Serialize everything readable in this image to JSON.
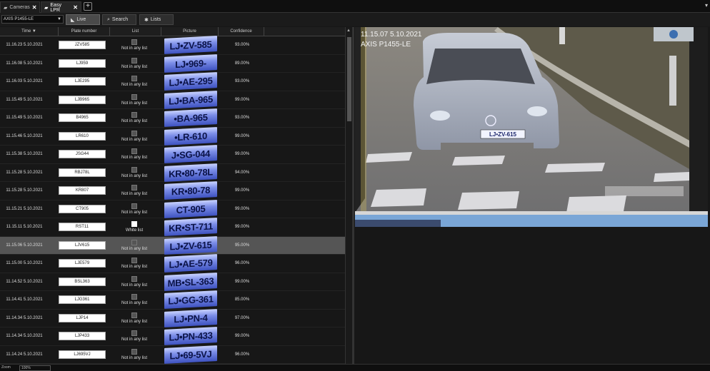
{
  "tabs": [
    {
      "label": "Cameras",
      "close": "✕"
    },
    {
      "label": "Easy LPR",
      "close": "✕"
    }
  ],
  "add_tab": "+",
  "menu_icon": "▾",
  "camera_select": {
    "value": "AXIS P1455-LE"
  },
  "toolbar": {
    "live_label": "Live",
    "search_label": "Search",
    "lists_label": "Lists"
  },
  "columns": {
    "time": "Time",
    "plate": "Plate number",
    "list": "List",
    "picture": "Picture",
    "confidence": "Confidence"
  },
  "rows": [
    {
      "time": "11.16.23 5.10.2021",
      "plate": "JZV585",
      "list": "Not in any list",
      "pic": "LJ•ZV-585",
      "conf": "93.00%"
    },
    {
      "time": "11.16.08 5.10.2021",
      "plate": "LJ959",
      "list": "Not in any list",
      "pic": "LJ•969-",
      "conf": "89.00%"
    },
    {
      "time": "11.16.03 5.10.2021",
      "plate": "LJE295",
      "list": "Not in any list",
      "pic": "LJ•AE-295",
      "conf": "93.00%"
    },
    {
      "time": "11.15.49 5.10.2021",
      "plate": "LJB965",
      "list": "Not in any list",
      "pic": "LJ•BA-965",
      "conf": "99.00%"
    },
    {
      "time": "11.15.49 5.10.2021",
      "plate": "B4965",
      "list": "Not in any list",
      "pic": "•BA-965",
      "conf": "93.00%"
    },
    {
      "time": "11.15.46 5.10.2021",
      "plate": "LR610",
      "list": "Not in any list",
      "pic": "•LR-610",
      "conf": "99.00%"
    },
    {
      "time": "11.15.38 5.10.2021",
      "plate": "JSG44",
      "list": "Not in any list",
      "pic": "J•SG-044",
      "conf": "99.00%"
    },
    {
      "time": "11.15.28 5.10.2021",
      "plate": "RBJ78L",
      "list": "Not in any list",
      "pic": "KR•80-78L",
      "conf": "94.00%"
    },
    {
      "time": "11.15.28 5.10.2021",
      "plate": "KR807",
      "list": "Not in any list",
      "pic": "KR•80-78",
      "conf": "99.00%"
    },
    {
      "time": "11.15.21 5.10.2021",
      "plate": "CT905",
      "list": "Not in any list",
      "pic": "CT-905",
      "conf": "99.00%"
    },
    {
      "time": "11.15.11 5.10.2021",
      "plate": "RST11",
      "list": "White list",
      "pic": "KR•ST-711",
      "conf": "99.00%",
      "white": true
    },
    {
      "time": "11.15.06 5.10.2021",
      "plate": "LJV615",
      "list": "Not in any list",
      "pic": "LJ•ZV-615",
      "conf": "95.00%",
      "selected": true
    },
    {
      "time": "11.15.00 5.10.2021",
      "plate": "LJE579",
      "list": "Not in any list",
      "pic": "LJ•AE-579",
      "conf": "96.00%"
    },
    {
      "time": "11.14.52 5.10.2021",
      "plate": "BSL363",
      "list": "Not in any list",
      "pic": "MB•SL-363",
      "conf": "99.00%"
    },
    {
      "time": "11.14.41 5.10.2021",
      "plate": "LJG361",
      "list": "Not in any list",
      "pic": "LJ•GG-361",
      "conf": "85.00%"
    },
    {
      "time": "11.14.34 5.10.2021",
      "plate": "LJP14",
      "list": "Not in any list",
      "pic": "LJ•PN-4",
      "conf": "97.00%"
    },
    {
      "time": "11.14.34 5.10.2021",
      "plate": "LJP433",
      "list": "Not in any list",
      "pic": "LJ•PN-433",
      "conf": "99.00%"
    },
    {
      "time": "11.14.24 5.10.2021",
      "plate": "LJ695VJ",
      "list": "Not in any list",
      "pic": "LJ•69-5VJ",
      "conf": "96.00%"
    }
  ],
  "video": {
    "timestamp": "11.15.07 5.10.2021",
    "camera": "AXIS P1455-LE",
    "car_plate": "LJ•ZV-615"
  },
  "statusbar": {
    "zoom_label": "Zoom",
    "zoom_value": "100%"
  },
  "colors": {
    "plate_blue": "#4d63d6",
    "selection": "#555555",
    "background": "#171717"
  }
}
